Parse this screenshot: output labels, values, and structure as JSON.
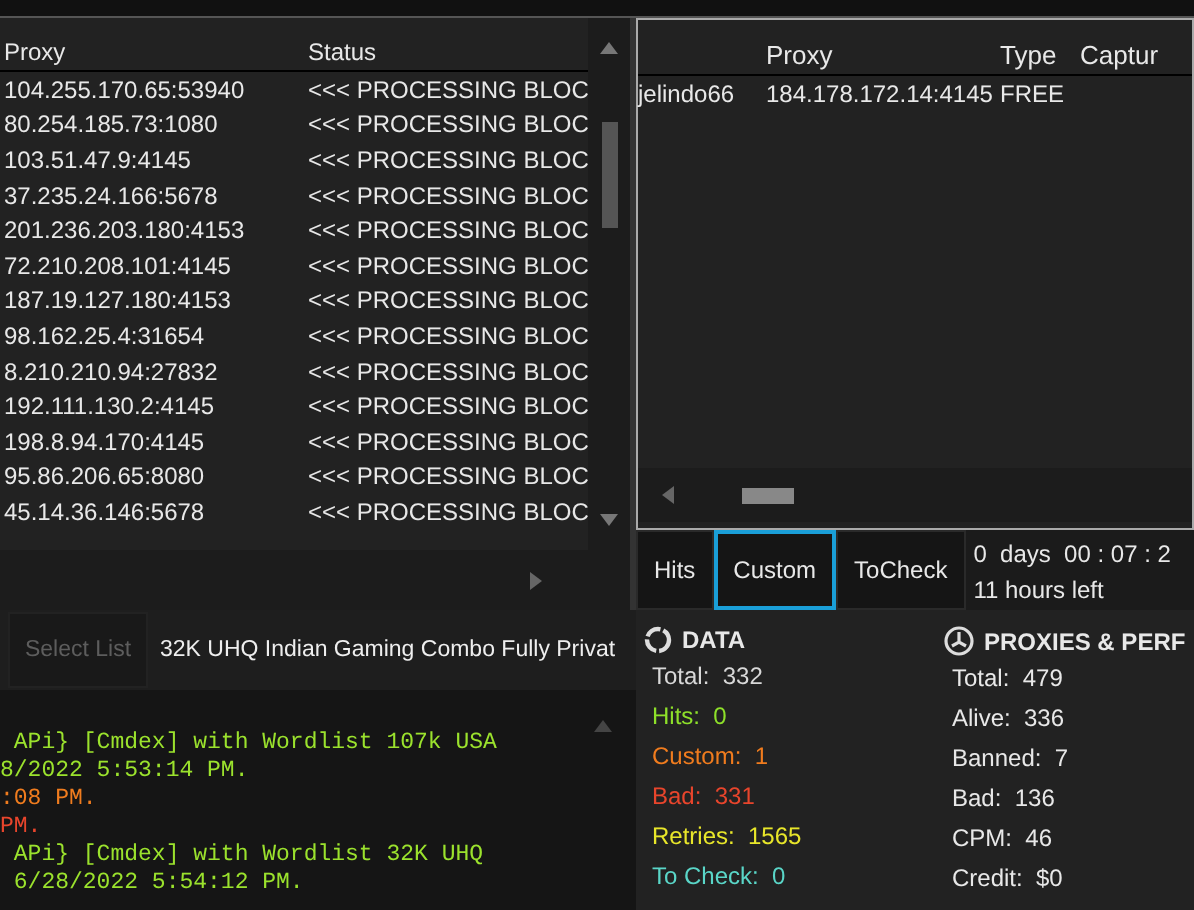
{
  "proxy_table": {
    "columns": [
      "Proxy",
      "Status"
    ],
    "rows": [
      [
        "104.255.170.65:53940",
        "<<< PROCESSING BLOC"
      ],
      [
        "80.254.185.73:1080",
        "<<< PROCESSING BLOC"
      ],
      [
        "103.51.47.9:4145",
        "<<< PROCESSING BLOC"
      ],
      [
        "37.235.24.166:5678",
        "<<< PROCESSING BLOC"
      ],
      [
        "201.236.203.180:4153",
        "<<< PROCESSING BLOC"
      ],
      [
        "72.210.208.101:4145",
        "<<< PROCESSING BLOC"
      ],
      [
        "187.19.127.180:4153",
        "<<< PROCESSING BLOC"
      ],
      [
        "98.162.25.4:31654",
        "<<< PROCESSING BLOC"
      ],
      [
        "8.210.210.94:27832",
        "<<< PROCESSING BLOC"
      ],
      [
        "192.111.130.2:4145",
        "<<< PROCESSING BLOC"
      ],
      [
        "198.8.94.170:4145",
        "<<< PROCESSING BLOC"
      ],
      [
        "95.86.206.65:8080",
        "<<< PROCESSING BLOC"
      ],
      [
        "45.14.36.146:5678",
        "<<< PROCESSING BLOC"
      ]
    ]
  },
  "hits_table": {
    "columns": [
      "",
      "Proxy",
      "Type",
      "Captur"
    ],
    "rows": [
      [
        "jelindo66",
        "184.178.172.14:4145",
        "FREE"
      ]
    ]
  },
  "result_tabs": [
    {
      "label": "Hits",
      "selected": false
    },
    {
      "label": "Custom",
      "selected": true
    },
    {
      "label": "ToCheck",
      "selected": false
    }
  ],
  "timer": {
    "elapsed": "0  days  00 : 07 : 2",
    "remaining": "11 hours left"
  },
  "wordlist": {
    "button": "Select List",
    "name": "32K UHQ Indian Gaming Combo Fully Privat"
  },
  "log": [
    {
      "text": " APi} [Cmdex] with Wordlist 107k USA",
      "color": "#9be22d"
    },
    {
      "text": "8/2022 5:53:14 PM.",
      "color": "#9be22d"
    },
    {
      "text": ":08 PM.",
      "color": "#f07c1e"
    },
    {
      "text": "PM.",
      "color": "#e8452c"
    },
    {
      "text": " APi} [Cmdex] with Wordlist 32K UHQ",
      "color": "#9be22d"
    },
    {
      "text": " 6/28/2022 5:54:12 PM.",
      "color": "#9be22d"
    }
  ],
  "data": {
    "title": "DATA",
    "stats": [
      {
        "label": "Total:",
        "value": "332",
        "color": "#d8d8d8"
      },
      {
        "label": "Hits:",
        "value": "0",
        "color": "#8ee02a"
      },
      {
        "label": "Custom:",
        "value": "1",
        "color": "#f07c1e"
      },
      {
        "label": "Bad:",
        "value": "331",
        "color": "#e8452c"
      },
      {
        "label": "Retries:",
        "value": "1565",
        "color": "#e8e62a"
      },
      {
        "label": "To Check:",
        "value": "0",
        "color": "#5ad6c8"
      }
    ]
  },
  "proxies": {
    "title": "PROXIES & PERF",
    "stats": [
      {
        "label": "Total:",
        "value": "479"
      },
      {
        "label": "Alive:",
        "value": "336"
      },
      {
        "label": "Banned:",
        "value": "7"
      },
      {
        "label": "Bad:",
        "value": "136"
      },
      {
        "label": "CPM:",
        "value": "46"
      },
      {
        "label": "Credit:",
        "value": "$0"
      }
    ]
  }
}
